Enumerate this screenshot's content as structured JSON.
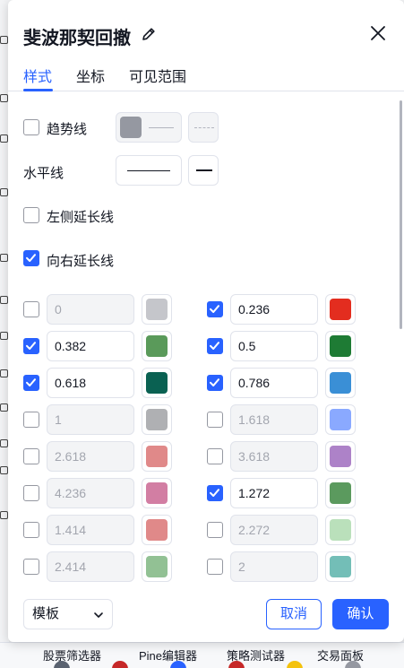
{
  "dialog": {
    "title": "斐波那契回撤",
    "tabs": [
      {
        "label": "样式",
        "active": true
      },
      {
        "label": "坐标",
        "active": false
      },
      {
        "label": "可见范围",
        "active": false
      }
    ]
  },
  "style": {
    "trend_line": {
      "label": "趋势线",
      "checked": false,
      "color": "#9598a1"
    },
    "horizontal_line": {
      "label": "水平线"
    },
    "extend_left": {
      "label": "左侧延长线",
      "checked": false
    },
    "extend_right": {
      "label": "向右延长线",
      "checked": true
    }
  },
  "levels": [
    {
      "value": "0",
      "enabled": false,
      "color": "#9598a1"
    },
    {
      "value": "0.236",
      "enabled": true,
      "color": "#e32d1f"
    },
    {
      "value": "0.382",
      "enabled": true,
      "color": "#5a9a5a"
    },
    {
      "value": "0.5",
      "enabled": true,
      "color": "#1e7b34"
    },
    {
      "value": "0.618",
      "enabled": true,
      "color": "#0a6152"
    },
    {
      "value": "0.786",
      "enabled": true,
      "color": "#3a8fd6"
    },
    {
      "value": "1",
      "enabled": false,
      "color": "#6d6f75"
    },
    {
      "value": "1.618",
      "enabled": false,
      "color": "#2962ff"
    },
    {
      "value": "2.618",
      "enabled": false,
      "color": "#c62828"
    },
    {
      "value": "3.618",
      "enabled": false,
      "color": "#6a1b9a"
    },
    {
      "value": "4.236",
      "enabled": false,
      "color": "#ad1457"
    },
    {
      "value": "1.272",
      "enabled": true,
      "color": "#5b9a5e"
    },
    {
      "value": "1.414",
      "enabled": false,
      "color": "#c62828"
    },
    {
      "value": "2.272",
      "enabled": false,
      "color": "#81c784"
    },
    {
      "value": "2.414",
      "enabled": false,
      "color": "#388e3c"
    },
    {
      "value": "2",
      "enabled": false,
      "color": "#00897b"
    }
  ],
  "footer": {
    "template_label": "模板",
    "cancel_label": "取消",
    "ok_label": "确认"
  },
  "background": {
    "bottom_tabs": [
      "股票筛选器",
      "Pine编辑器",
      "策略测试器",
      "交易面板"
    ]
  },
  "colors": {
    "accent": "#2962ff",
    "border": "#e0e3eb",
    "text": "#131722",
    "disabled_text": "#a3a6af"
  }
}
